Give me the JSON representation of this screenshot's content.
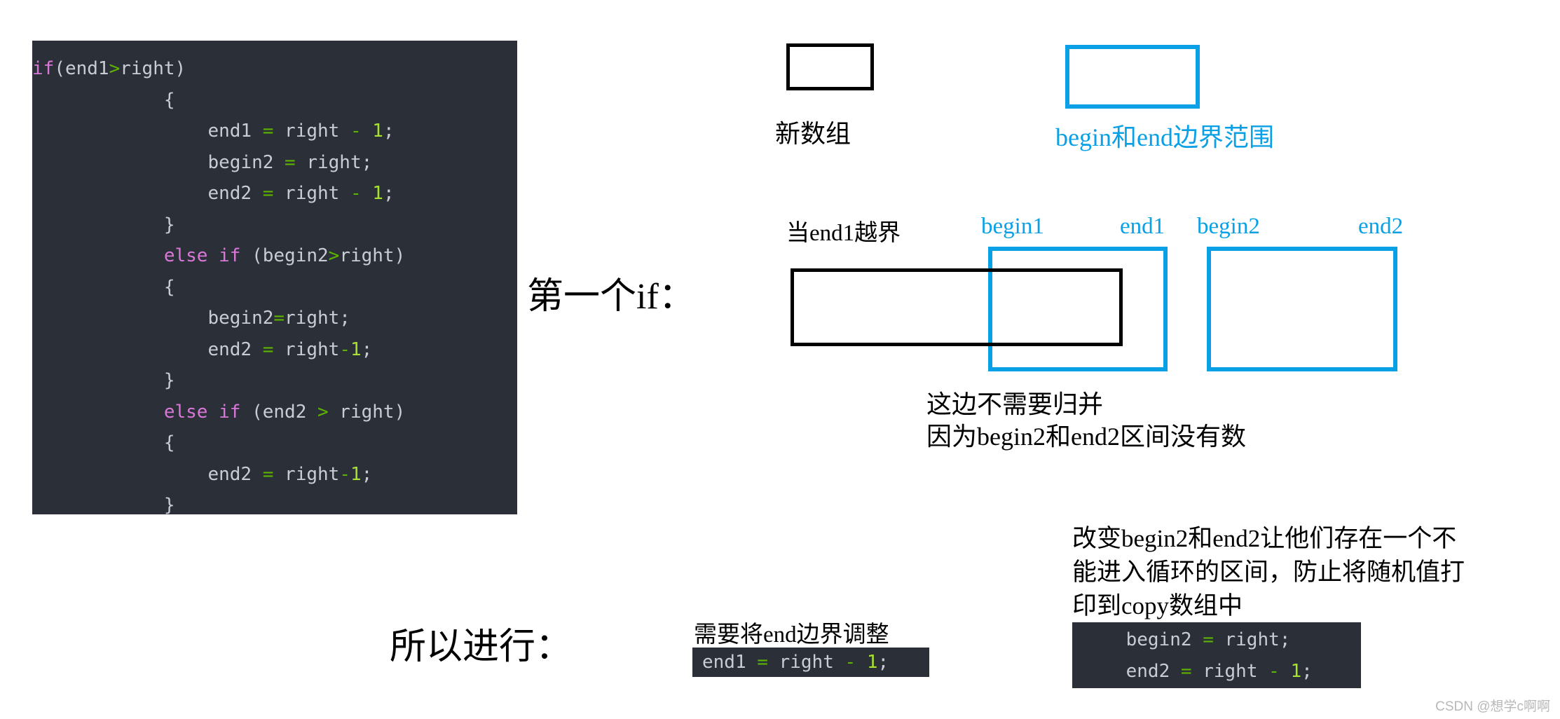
{
  "colors": {
    "blue_accent": "#0aa0e6",
    "black": "#000000",
    "code_bg": "#2b2f38",
    "code_text": "#c8ccd4",
    "code_keyword": "#d977d9",
    "code_operator": "#5eb300",
    "code_number": "#a6e22e",
    "watermark": "#b8b8b8"
  },
  "main_code": {
    "lines": [
      [
        {
          "t": "if",
          "c": "kw"
        },
        {
          "t": "(end1",
          "c": "pl"
        },
        {
          "t": ">",
          "c": "op"
        },
        {
          "t": "right)",
          "c": "pl"
        }
      ],
      [
        {
          "t": "            {",
          "c": "pl"
        }
      ],
      [
        {
          "t": "                end1 ",
          "c": "pl"
        },
        {
          "t": "=",
          "c": "op"
        },
        {
          "t": " right ",
          "c": "pl"
        },
        {
          "t": "-",
          "c": "op"
        },
        {
          "t": " ",
          "c": "pl"
        },
        {
          "t": "1",
          "c": "num"
        },
        {
          "t": ";",
          "c": "pl"
        }
      ],
      [
        {
          "t": "                begin2 ",
          "c": "pl"
        },
        {
          "t": "=",
          "c": "op"
        },
        {
          "t": " right;",
          "c": "pl"
        }
      ],
      [
        {
          "t": "                end2 ",
          "c": "pl"
        },
        {
          "t": "=",
          "c": "op"
        },
        {
          "t": " right ",
          "c": "pl"
        },
        {
          "t": "-",
          "c": "op"
        },
        {
          "t": " ",
          "c": "pl"
        },
        {
          "t": "1",
          "c": "num"
        },
        {
          "t": ";",
          "c": "pl"
        }
      ],
      [
        {
          "t": "            }",
          "c": "pl"
        }
      ],
      [
        {
          "t": "            ",
          "c": "pl"
        },
        {
          "t": "else if",
          "c": "kw"
        },
        {
          "t": " (begin2",
          "c": "pl"
        },
        {
          "t": ">",
          "c": "op"
        },
        {
          "t": "right)",
          "c": "pl"
        }
      ],
      [
        {
          "t": "            {",
          "c": "pl"
        }
      ],
      [
        {
          "t": "                begin2",
          "c": "pl"
        },
        {
          "t": "=",
          "c": "op"
        },
        {
          "t": "right;",
          "c": "pl"
        }
      ],
      [
        {
          "t": "                end2 ",
          "c": "pl"
        },
        {
          "t": "=",
          "c": "op"
        },
        {
          "t": " right",
          "c": "pl"
        },
        {
          "t": "-",
          "c": "op"
        },
        {
          "t": "1",
          "c": "num"
        },
        {
          "t": ";",
          "c": "pl"
        }
      ],
      [
        {
          "t": "            }",
          "c": "pl"
        }
      ],
      [
        {
          "t": "            ",
          "c": "pl"
        },
        {
          "t": "else if",
          "c": "kw"
        },
        {
          "t": " (end2 ",
          "c": "pl"
        },
        {
          "t": ">",
          "c": "op"
        },
        {
          "t": " right)",
          "c": "pl"
        }
      ],
      [
        {
          "t": "            {",
          "c": "pl"
        }
      ],
      [
        {
          "t": "                end2 ",
          "c": "pl"
        },
        {
          "t": "=",
          "c": "op"
        },
        {
          "t": " right",
          "c": "pl"
        },
        {
          "t": "-",
          "c": "op"
        },
        {
          "t": "1",
          "c": "num"
        },
        {
          "t": ";",
          "c": "pl"
        }
      ],
      [
        {
          "t": "            }",
          "c": "pl"
        }
      ]
    ]
  },
  "legend": {
    "black_label": "新数组",
    "blue_label": "begin和end边界范围"
  },
  "diagram": {
    "title": "当end1越界",
    "label_begin1": "begin1",
    "label_end1": "end1",
    "label_begin2": "begin2",
    "label_end2": "end2",
    "note_merge": "这边不需要归并\n因为begin2和end2区间没有数"
  },
  "headings": {
    "first_if": "第一个if：",
    "so_do": "所以进行："
  },
  "bottom": {
    "note_adjust": "需要将end边界调整",
    "note_change": "改变begin2和end2让他们存在一个不\n能进入循环的区间，防止将随机值打\n印到copy数组中"
  },
  "snippet_end1": {
    "lines": [
      [
        {
          "t": "end1 ",
          "c": "pl"
        },
        {
          "t": "=",
          "c": "op"
        },
        {
          "t": " right ",
          "c": "pl"
        },
        {
          "t": "-",
          "c": "op"
        },
        {
          "t": " ",
          "c": "pl"
        },
        {
          "t": "1",
          "c": "num"
        },
        {
          "t": ";",
          "c": "pl"
        }
      ]
    ]
  },
  "snippet_begin2end2": {
    "lines": [
      [
        {
          "t": "    begin2 ",
          "c": "pl"
        },
        {
          "t": "=",
          "c": "op"
        },
        {
          "t": " right;",
          "c": "pl"
        }
      ],
      [
        {
          "t": "    end2 ",
          "c": "pl"
        },
        {
          "t": "=",
          "c": "op"
        },
        {
          "t": " right ",
          "c": "pl"
        },
        {
          "t": "-",
          "c": "op"
        },
        {
          "t": " ",
          "c": "pl"
        },
        {
          "t": "1",
          "c": "num"
        },
        {
          "t": ";",
          "c": "pl"
        }
      ]
    ]
  },
  "watermark": "CSDN @想学c啊啊"
}
